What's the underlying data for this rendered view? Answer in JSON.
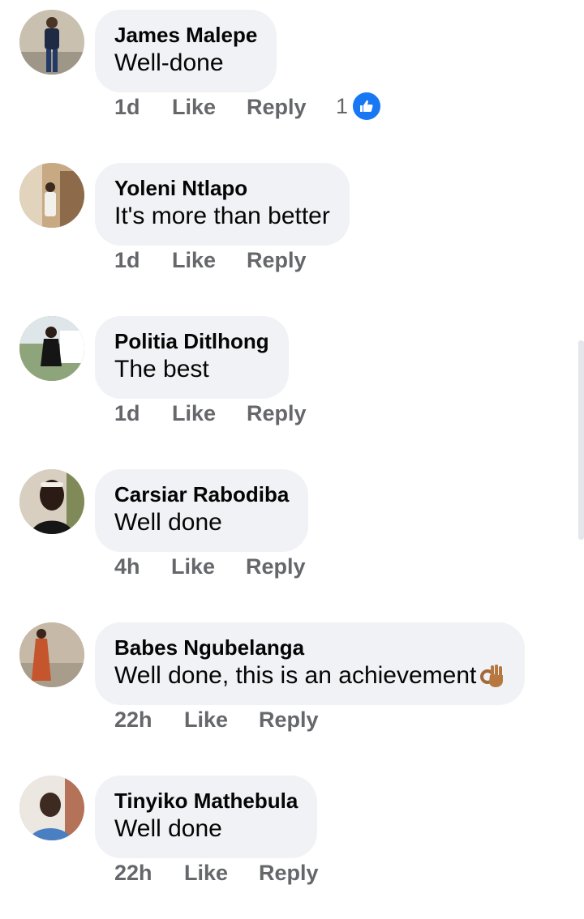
{
  "comments": [
    {
      "author": "James Malepe",
      "text": "Well-done",
      "time": "1d",
      "like_label": "Like",
      "reply_label": "Reply",
      "reaction_count": "1",
      "avatar_icon": "person-avatar"
    },
    {
      "author": "Yoleni Ntlapo",
      "text": "It's more than better",
      "time": "1d",
      "like_label": "Like",
      "reply_label": "Reply",
      "avatar_icon": "person-avatar"
    },
    {
      "author": "Politia Ditlhong",
      "text": "The best",
      "time": "1d",
      "like_label": "Like",
      "reply_label": "Reply",
      "avatar_icon": "person-avatar"
    },
    {
      "author": "Carsiar Rabodiba",
      "text": "Well done",
      "time": "4h",
      "like_label": "Like",
      "reply_label": "Reply",
      "avatar_icon": "person-avatar"
    },
    {
      "author": "Babes Ngubelanga",
      "text": "Well done, this is an achievement",
      "emoji": "ok-hand-emoji",
      "time": "22h",
      "like_label": "Like",
      "reply_label": "Reply",
      "avatar_icon": "person-avatar"
    },
    {
      "author": "Tinyiko Mathebula",
      "text": "Well done",
      "time": "22h",
      "like_label": "Like",
      "reply_label": "Reply",
      "avatar_icon": "person-avatar"
    }
  ],
  "colors": {
    "bubble": "#f0f2f5",
    "meta_text": "#65676b",
    "like_blue": "#1877f2",
    "name_text": "#050505"
  }
}
